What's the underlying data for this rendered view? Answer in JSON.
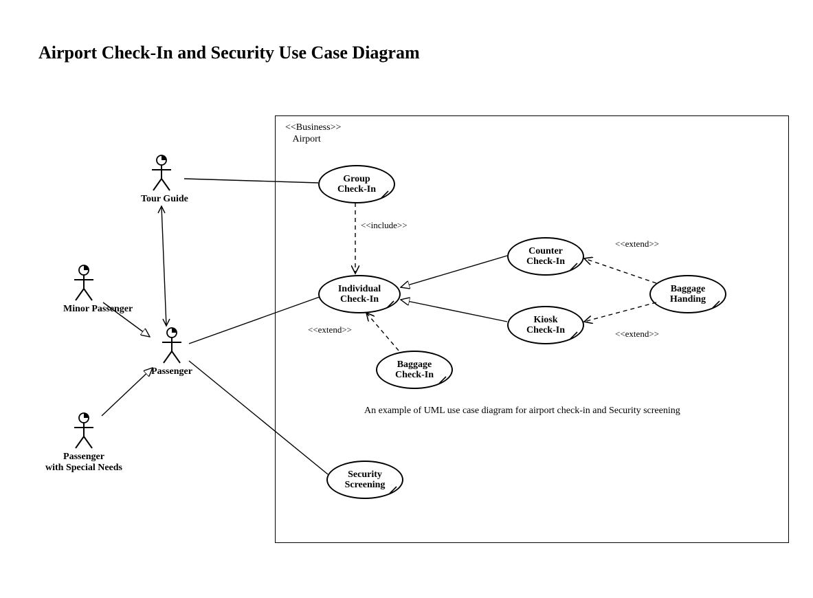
{
  "title": "Airport Check-In and Security Use Case Diagram",
  "business": {
    "stereotype": "<<Business>>",
    "name": "Airport"
  },
  "actors": {
    "tour_guide": "Tour Guide",
    "minor_passenger": "Minor Passenger",
    "passenger": "Passenger",
    "special_needs_line1": "Passenger",
    "special_needs_line2": "with Special Needs"
  },
  "usecases": {
    "group_checkin": "Group\nCheck-In",
    "individual_checkin": "Individual\nCheck-In",
    "counter_checkin": "Counter\nCheck-In",
    "kiosk_checkin": "Kiosk\nCheck-In",
    "baggage_handing": "Baggage\nHanding",
    "baggage_checkin": "Baggage\nCheck-In",
    "security_screening": "Security\nScreening"
  },
  "stereotypes": {
    "include": "<<include>>",
    "extend": "<<extend>>"
  },
  "caption": "An example of UML use case diagram for airport check-in and Security screening"
}
